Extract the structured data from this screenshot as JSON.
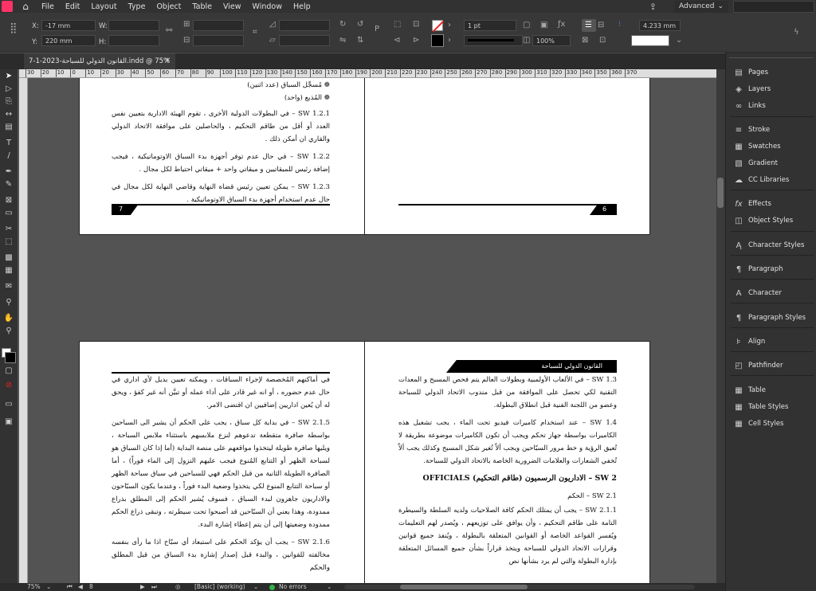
{
  "menubar": {
    "items": [
      "File",
      "Edit",
      "Layout",
      "Type",
      "Object",
      "Table",
      "View",
      "Window",
      "Help"
    ],
    "workspace": "Advanced"
  },
  "control": {
    "x_label": "X:",
    "x_value": "-17 mm",
    "y_label": "Y:",
    "y_value": "220 mm",
    "w_label": "W:",
    "h_label": "H:",
    "stroke_weight": "1 pt",
    "zoom_pct": "100%",
    "gap_value": "4.233 mm"
  },
  "document": {
    "tab_title": "7-1-2023-القانون الدولي للسباحة.indd @ 75%"
  },
  "ruler": {
    "ticks": [
      "30",
      "20",
      "10",
      "0",
      "10",
      "20",
      "30",
      "40",
      "50",
      "60",
      "70",
      "80",
      "90",
      "100",
      "110",
      "120",
      "130",
      "140",
      "150",
      "160",
      "170",
      "180",
      "190",
      "200",
      "210",
      "220",
      "230",
      "240",
      "250",
      "260",
      "270",
      "280",
      "290",
      "300",
      "310",
      "320",
      "330",
      "340",
      "350",
      "360",
      "370"
    ]
  },
  "pages": {
    "top_left": {
      "bullets": [
        "مُسجِّل السباق (عدد اثنين)",
        "المُذيع (واحد)"
      ],
      "paragraphs": [
        "SW 1.2.1 – في البطولات الدولية الأخرى ، تقوم الهيئة الادارية بتعيين نفس العدد أو أقل من طاقم التحكيم ، والحاصلين على موافقة الاتحاد الدولي والقاري ان أمكن ذلك .",
        "SW 1.2.2 – في حال عدم توفر أجهزة بدء السباق الاوتوماتيكية ، فيجب إضافة رئيس للميقاتيين و ميقاتي واحد + ميقاتي احتياط لكل مجال .",
        "SW 1.2.3 – يمكن تعيين رئيس قضاة النهاية وقاضي النهاية لكل مجال في حال عدم استخدام أجهزة بدء السباق الاوتوماتيكية ."
      ],
      "page_number": "7"
    },
    "top_right": {
      "page_number": "6"
    },
    "bottom_left": {
      "paragraphs": [
        "في أماكنهم المُخصصة لإجراء السباقات ، ويمكنه تعيين بديل لأي اداري في حال عدم حضوره ، أو انه غير قادر على أداء عمله أو تبيَّن أنه غير كفؤ ، ويحق له أن يُعين اداريين إضافيين ان اقتضى الامر.",
        "SW 2.1.5 – في بداية كل سباق ، يجب على الحكم أن يشير الى السباحين بواسطة صافرة متقطعة تدعوهم لنزع ملابسهم باستثناء ملابس السباحة ، ويليها صافرة طويلة ليتخذوا مواقعهم على منصة البداية (أما إذا كان السباق هو لسباحة الظهر أو التتابع المُنوع فيجب عليهم النزول إلى الماء فوراً) ، أما الصافرة الطويلة الثانية من قبل الحكم فهي للسباحين في سباق سباحة الظهر أو سباحة التتابع المنوع لكي يتخذوا وضعية البدء فوراً ، وعندما يكون السبّاحون والاداريون جاهزون لبدء السباق ، فسوف يُشير الحكم إلى المطلق بذراع ممدودة، وهذا يعني أن السبّاحين قد أصبحوا تحت سيطرته ، وتبقى ذراع الحكم ممدودة وضعيتها إلى أن يتم إعطاء إشارة البدء.",
        "SW 2.1.6 – يجب أن يؤكد الحكم على استبعاد أي سبّاح اذا ما رأى بنفسه مخالفته للقوانين ، والبدء قبل إصدار إشارة بدء السباق من قبل المطلق والحكم"
      ]
    },
    "bottom_right": {
      "header": "القانون الدولي للسباحة",
      "paragraphs": [
        "SW 1.3 – في الألعاب الأولمبية وبطولات العالم يتم فحص المسبح و المعدات التقنية لكي تحصل على الموافقة من قبل مندوب الاتحاد الدولي للسباحة وعضو من اللجنة الفنية قبل انطلاق البطولة.",
        "SW 1.4 – عند استخدام كاميرات فيديو تحت الماء ، يجب تشغيل هذه الكاميرات بواسطة جهاز تحكم ويجب أن تكون الكاميرات موضوعة بطريقة لا تُعيق الرؤية و خط مرور السبّاحين ويجب ألاّ تُغير شكل المسبح وكذلك يجب ألاّ تُخفي الشعارات والعلامات الضرورية الخاصة بالاتحاد الدولي للسباحة."
      ],
      "section_title": "SW 2 – الاداريون الرسميون (طاقم التحكيم) OFFICIALS",
      "subsection": "SW 2.1 – الحكم",
      "paragraph_after": "SW 2.1.1 – يجب أن يمتلك الحكم كافة الصلاحيات ولديه السلطة والسيطرة التامة على طاقم التحكيم ، وأن يوافق على توزيعهم ، ويُصدر لهم التعليمات ويُفسر القواعد الخاصة أو القوانين المتعلقة بالبطولة ، ويُنفذ جميع قوانين وقرارات الاتحاد الدولي للسباحة ويتخذ قراراً بشأن جميع المسائل المتعلقة بإدارة البطولة والتي لم يرد بشأنها نص"
    }
  },
  "panels": {
    "items": [
      "Pages",
      "Layers",
      "Links",
      "Stroke",
      "Swatches",
      "Gradient",
      "CC Libraries",
      "Effects",
      "Object Styles",
      "Character Styles",
      "Paragraph",
      "Character",
      "Paragraph Styles",
      "Align",
      "Pathfinder",
      "Table",
      "Table Styles",
      "Cell Styles"
    ],
    "effects_glyph": "fx"
  },
  "status": {
    "zoom": "75%",
    "page": "8",
    "style": "[Basic] (working)",
    "errors": "No errors"
  },
  "colors": {
    "accent": "#4a7fd4",
    "preflight_ok": "#33b24a",
    "app_badge": "#ff3366"
  }
}
